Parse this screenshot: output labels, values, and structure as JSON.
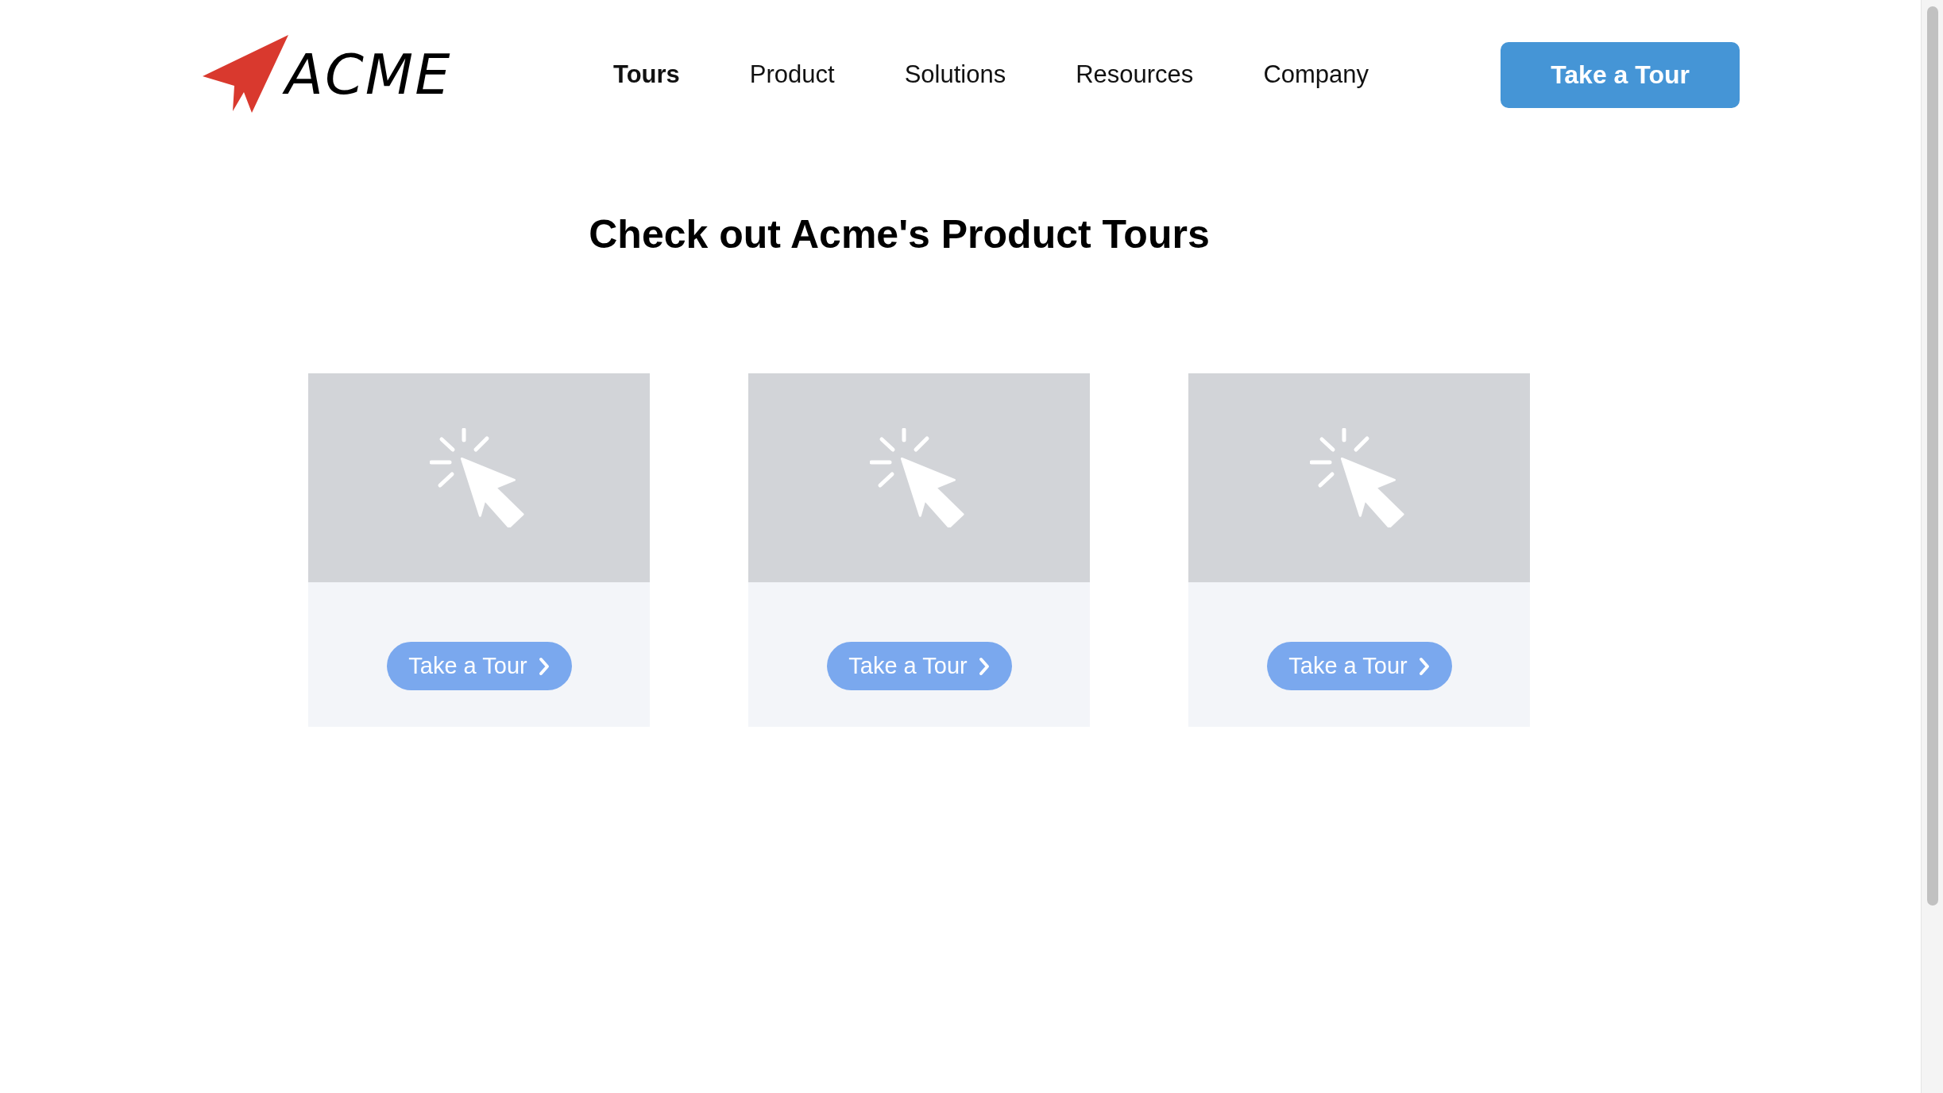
{
  "header": {
    "logo": {
      "text": "ACME"
    },
    "nav": [
      {
        "label": "Tours",
        "selected": true
      },
      {
        "label": "Product",
        "selected": false
      },
      {
        "label": "Solutions",
        "selected": false
      },
      {
        "label": "Resources",
        "selected": false
      },
      {
        "label": "Company",
        "selected": false
      }
    ],
    "cta": "Take a Tour"
  },
  "heading": "Check out Acme's Product Tours",
  "cards": [
    {
      "button": "Take a Tour"
    },
    {
      "button": "Take a Tour"
    },
    {
      "button": "Take a Tour"
    }
  ]
}
